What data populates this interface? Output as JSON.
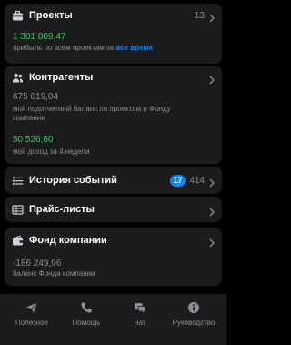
{
  "projects": {
    "title": "Проекты",
    "count": "13",
    "profit_value": "1 301 809,47",
    "profit_caption_prefix": "прибыль по всем проектам за",
    "profit_caption_link": "все время",
    "icon": "briefcase-icon"
  },
  "contractors": {
    "title": "Контрагенты",
    "balance_value": "675 019,04",
    "balance_caption": "мой подотчетный баланс по проектам и Фонду компании",
    "income_value": "50 526,60",
    "income_caption": "мой доход за 4 недели",
    "icon": "people-icon"
  },
  "events": {
    "title": "История событий",
    "badge": "17",
    "count": "414",
    "icon": "list-icon"
  },
  "pricelists": {
    "title": "Прайс-листы",
    "icon": "table-icon"
  },
  "fund": {
    "title": "Фонд компании",
    "balance_value": "-186 249,96",
    "balance_caption": "баланс Фонда компании",
    "icon": "wallet-icon"
  },
  "tabbar": {
    "tabs": [
      {
        "label": "Полезное",
        "icon": "send-icon"
      },
      {
        "label": "Помощь",
        "icon": "phone-icon"
      },
      {
        "label": "Чат",
        "icon": "chat-icon"
      },
      {
        "label": "Руководство",
        "icon": "info-icon"
      }
    ]
  },
  "colors": {
    "background": "#000000",
    "card": "#1c1c1e",
    "accent": "#0a84ff",
    "positive": "#34c759",
    "muted": "#8e8e93"
  }
}
